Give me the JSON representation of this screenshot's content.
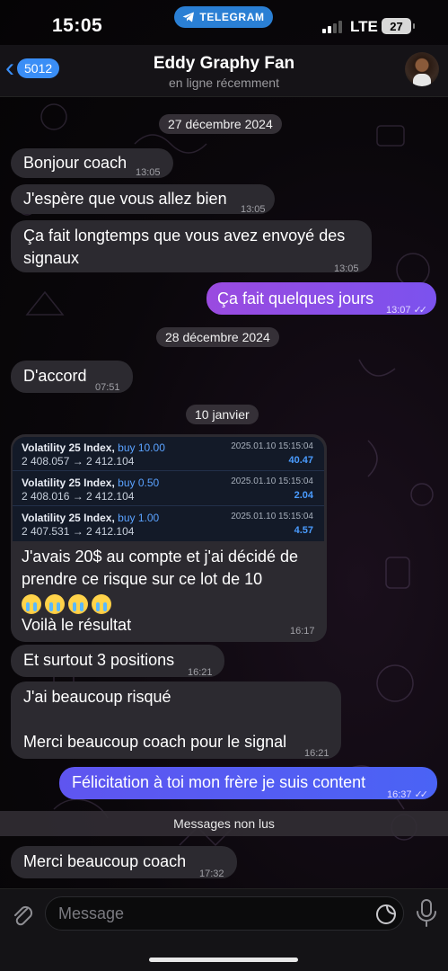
{
  "status_bar": {
    "time": "15:05",
    "app_pill": "TELEGRAM",
    "network": "LTE",
    "battery": "27"
  },
  "header": {
    "back_count": "5012",
    "contact_name": "Eddy Graphy Fan",
    "contact_status": "en ligne récemment"
  },
  "dates": {
    "d1": "27 décembre 2024",
    "d2": "28 décembre 2024",
    "d3": "10 janvier"
  },
  "messages": {
    "m1": {
      "text": "Bonjour coach",
      "time": "13:05"
    },
    "m2": {
      "text": "J'espère que vous allez bien",
      "time": "13:05"
    },
    "m3": {
      "line1": "Ça fait longtemps que vous avez envoyé des",
      "line2": "signaux",
      "time": "13:05"
    },
    "m4": {
      "text": "Ça fait quelques jours",
      "time": "13:07"
    },
    "m5": {
      "text": "D'accord",
      "time": "07:51"
    },
    "m6": {
      "line1": "J'avais 20$ au compte et j'ai décidé de",
      "line2": "prendre ce risque sur ce lot de 10",
      "line4": "Voilà le résultat",
      "time": "16:17"
    },
    "m7": {
      "text": "Et surtout 3 positions",
      "time": "16:21"
    },
    "m8": {
      "line1": "J'ai beaucoup risqué",
      "line2": "Merci beaucoup coach pour le signal",
      "time": "16:21"
    },
    "m9": {
      "text": "Félicitation à toi mon frère je suis content",
      "time": "16:37"
    },
    "m10": {
      "text": "Merci beaucoup coach",
      "time": "17:32"
    }
  },
  "trades": [
    {
      "symbol": "Volatility 25 Index,",
      "side": "buy 10.00",
      "prices": "2 408.057 → 2 412.104",
      "date": "2025.01.10 15:15:04",
      "profit": "40.47"
    },
    {
      "symbol": "Volatility 25 Index,",
      "side": "buy 0.50",
      "prices": "2 408.016 → 2 412.104",
      "date": "2025.01.10 15:15:04",
      "profit": "2.04"
    },
    {
      "symbol": "Volatility 25 Index,",
      "side": "buy 1.00",
      "prices": "2 407.531 → 2 412.104",
      "date": "2025.01.10 15:15:04",
      "profit": "4.57"
    }
  ],
  "unread_label": "Messages non lus",
  "composer": {
    "placeholder": "Message"
  },
  "colors": {
    "accent": "#3a8ef6",
    "outgoing": "#8a4fe8",
    "incoming": "#2c2a30"
  },
  "icons": [
    "telegram-icon",
    "back-chevron-icon",
    "attach-icon",
    "sticker-icon",
    "mic-icon",
    "double-check-icon"
  ]
}
